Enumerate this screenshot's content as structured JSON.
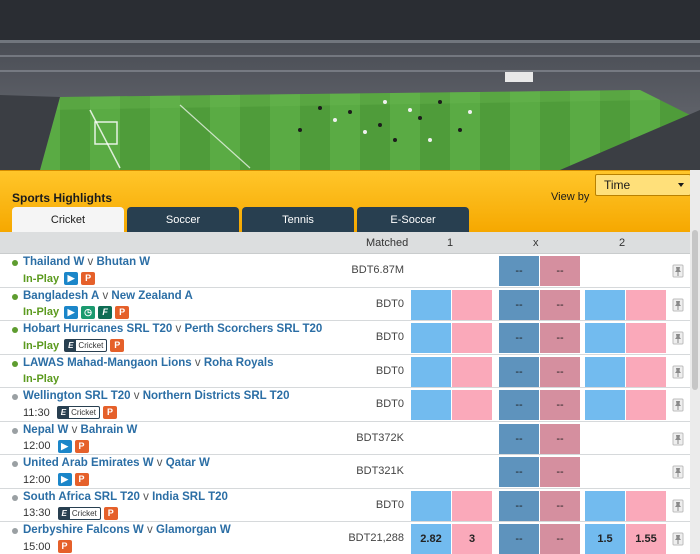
{
  "header": {
    "title": "Sports Highlights",
    "view_by_label": "View by",
    "view_by_value": "Time"
  },
  "tabs": [
    {
      "label": "Cricket",
      "active": true
    },
    {
      "label": "Soccer",
      "active": false
    },
    {
      "label": "Tennis",
      "active": false
    },
    {
      "label": "E-Soccer",
      "active": false
    }
  ],
  "columns": {
    "matched": "Matched",
    "one": "1",
    "x": "x",
    "two": "2"
  },
  "colors": {
    "back": "#72bbef",
    "lay": "#faa9ba",
    "accent": "#f6a800",
    "tab_dark": "#283f50",
    "link": "#2b6ea5"
  },
  "rows": [
    {
      "team_a": "Thailand W",
      "v": "v",
      "team_b": "Bhutan W",
      "status": "In-Play",
      "time": "",
      "icons": [
        "tv-icon",
        "p-icon"
      ],
      "matched": "BDT6.87M",
      "odds": [
        "",
        "",
        "--",
        "--",
        "",
        ""
      ],
      "live": true
    },
    {
      "team_a": "Bangladesh A",
      "v": "v",
      "team_b": "New Zealand A",
      "status": "In-Play",
      "time": "",
      "icons": [
        "tv-icon",
        "clock-icon",
        "f-icon",
        "p-icon"
      ],
      "matched": "BDT0",
      "odds": [
        "",
        "",
        "--",
        "--",
        "",
        ""
      ],
      "live": true
    },
    {
      "team_a": "Hobart Hurricanes SRL T20",
      "v": "v",
      "team_b": "Perth Scorchers SRL T20",
      "status": "In-Play",
      "time": "",
      "icons": [
        "cricket-badge",
        "p-icon"
      ],
      "matched": "BDT0",
      "odds": [
        "",
        "",
        "--",
        "--",
        "",
        ""
      ],
      "live": true
    },
    {
      "team_a": "LAWAS Mahad-Mangaon Lions",
      "v": "v",
      "team_b": "Roha Royals",
      "status": "In-Play",
      "time": "",
      "icons": [],
      "matched": "BDT0",
      "odds": [
        "",
        "",
        "--",
        "--",
        "",
        ""
      ],
      "live": true
    },
    {
      "team_a": "Wellington SRL T20",
      "v": "v",
      "team_b": "Northern Districts SRL T20",
      "status": "",
      "time": "11:30",
      "icons": [
        "cricket-badge",
        "p-icon"
      ],
      "matched": "BDT0",
      "odds": [
        "",
        "",
        "--",
        "--",
        "",
        ""
      ],
      "live": false
    },
    {
      "team_a": "Nepal W",
      "v": "v",
      "team_b": "Bahrain W",
      "status": "",
      "time": "12:00",
      "icons": [
        "tv-icon",
        "p-icon"
      ],
      "matched": "BDT372K",
      "odds": [
        "",
        "",
        "--",
        "--",
        "",
        ""
      ],
      "live": false
    },
    {
      "team_a": "United Arab Emirates W",
      "v": "v",
      "team_b": "Qatar W",
      "status": "",
      "time": "12:00",
      "icons": [
        "tv-icon",
        "p-icon"
      ],
      "matched": "BDT321K",
      "odds": [
        "",
        "",
        "--",
        "--",
        "",
        ""
      ],
      "live": false
    },
    {
      "team_a": "South Africa SRL T20",
      "v": "v",
      "team_b": "India SRL T20",
      "status": "",
      "time": "13:30",
      "icons": [
        "cricket-badge",
        "p-icon"
      ],
      "matched": "BDT0",
      "odds": [
        "",
        "",
        "--",
        "--",
        "",
        ""
      ],
      "live": false
    },
    {
      "team_a": "Derbyshire Falcons W",
      "v": "v",
      "team_b": "Glamorgan W",
      "status": "",
      "time": "15:00",
      "icons": [
        "p-icon"
      ],
      "matched": "BDT21,288",
      "odds": [
        "2.82",
        "3",
        "--",
        "--",
        "1.5",
        "1.55"
      ],
      "live": false
    }
  ],
  "badge_cricket_label": "Cricket"
}
